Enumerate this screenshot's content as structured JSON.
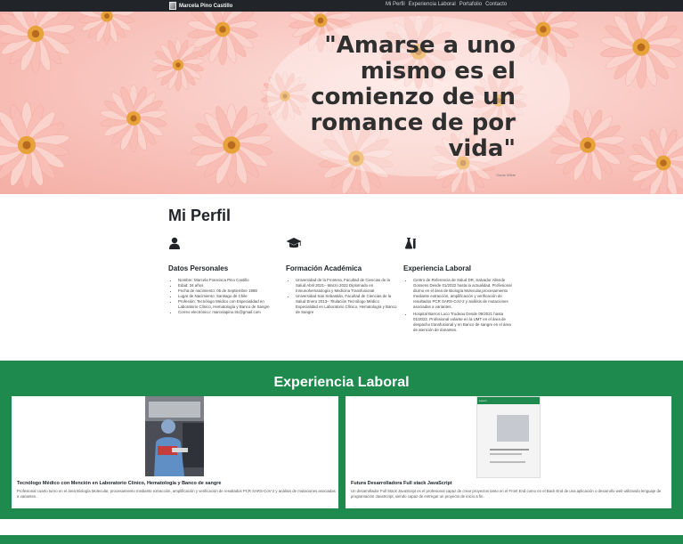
{
  "navbar": {
    "brand": "Marcela Pino Castillo",
    "links": [
      "Mi Perfil",
      "Experiencia Laboral",
      "Portafolio",
      "Contacto"
    ]
  },
  "hero": {
    "quote": "\"Amarse a uno mismo es el comienzo de un romance de por vida\"",
    "author": "Oscar Wilde"
  },
  "perfil": {
    "title": "Mi Perfil",
    "columns": [
      {
        "icon": "user-icon",
        "title": "Datos Personales",
        "items": [
          "Nombre: Marcela Francisca Pino Castillo",
          "Edad: 34 años",
          "Fecha de nacimiento: 05 de Septiembre 1988",
          "Lugar de Nacimiento: Santiago de Chile",
          "Profesión: Tecnólogo Médico con Especialidad en Laboratorio Clínico, Hematología y Banco de Sangre",
          "Correo electrónico: marcelapino.tm@gmail.com"
        ]
      },
      {
        "icon": "graduation-cap-icon",
        "title": "Formación Académica",
        "items": [
          "Universidad de la Frontera, Facultad de Ciencias de la Salud Abril 2021– Marzo 2022 Diplomado en Inmunohematología y Medicina Transfusional",
          "Universidad San Sebastián, Facultad de Ciencias de la Salud Enero 2013– Titulación Tecnólogo Médico Especialidad en Laboratorio Clínico, Hematología y Banco de Sangre"
        ]
      },
      {
        "icon": "flask-icon",
        "title": "Experiencia Laboral",
        "items": [
          "Centro de Referencia de Salud DR. Salvador Allende Gossens Desde 01/2022 hasta la actualidad. Profesional diurno en el área de Biología Molecular,procesamiento mediante extracción, amplificación y verificación de resultados PCR SARS-CoV-2 y análisis de mutaciones asociadas a variantes.",
          "Hospital Barros Luco Trudeau Desde 09/2021 hasta 01/2022. Profesional volante en la UMT en el área de despacho transfusional y en Banco de sangre en el área de atención de donantes."
        ]
      }
    ]
  },
  "experiencia": {
    "title": "Experiencia Laboral",
    "cards": [
      {
        "title": "Tecnólogo Médico con Mención en Laboratorio Clínico, Hematología y Banco de sangre",
        "text": "Profesional cuarto turno en el área Biología Molecular, procesamiento mediante extracción, amplificación y verificación de resultados PCR SARS-CoV-2 y análisis de mutaciones asociadas a variantes."
      },
      {
        "title": "Futura Desarrolladora Full stack JavaScript",
        "text": "Un desarrollador Full Stack JavaScript es el profesional capaz de crear proyectos tanto en el Front End como en el Back End de una aplicación o desarrollo web utilizando lenguaje de programación JavaScript, siendo capaz de entregar un proyecto de inicio a fin.",
        "thumb_header": "Lorem"
      }
    ]
  },
  "colors": {
    "navbar": "#212529",
    "green": "#1e8a4e",
    "petal": "#f7b3aa"
  }
}
